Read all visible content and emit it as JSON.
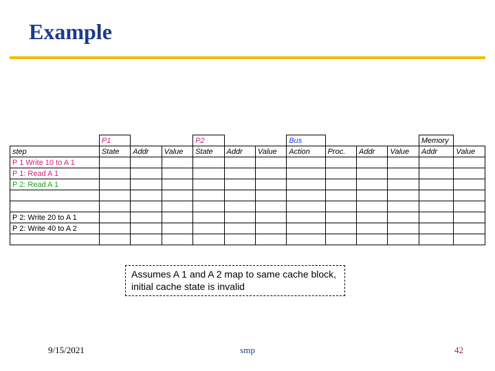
{
  "title": "Example",
  "headers": {
    "p1": "P1",
    "p2": "P2",
    "bus": "Bus",
    "memory": "Memory",
    "step": "step",
    "state": "State",
    "addr": "Addr",
    "value": "Value",
    "action": "Action",
    "proc": "Proc."
  },
  "steps": [
    {
      "label": "P 1 Write 10 to A 1",
      "class": "step-red"
    },
    {
      "label": "P 1: Read A 1",
      "class": "step-red"
    },
    {
      "label": "P 2: Read A 1",
      "class": "step-green"
    },
    {
      "label": "",
      "class": "step-shade"
    },
    {
      "label": "",
      "class": "step-shade"
    },
    {
      "label": "P 2: Write 20 to A 1",
      "class": "step-black"
    },
    {
      "label": "P 2: Write 40 to A 2",
      "class": "step-black"
    },
    {
      "label": "",
      "class": "step-shade"
    }
  ],
  "note": "Assumes A 1 and A 2 map to same cache block, initial cache state is invalid",
  "footer": {
    "date": "9/15/2021",
    "center": "smp",
    "page": "42"
  },
  "chart_data": {
    "type": "table",
    "title": "Example",
    "group_headers": [
      "",
      "P1",
      "P2",
      "Bus",
      "Memory"
    ],
    "columns": [
      "step",
      "State",
      "Addr",
      "Value",
      "State",
      "Addr",
      "Value",
      "Action",
      "Proc.",
      "Addr",
      "Value",
      "Addr",
      "Value"
    ],
    "rows": [
      [
        "P 1 Write 10 to A 1",
        "",
        "",
        "",
        "",
        "",
        "",
        "",
        "",
        "",
        "",
        "",
        ""
      ],
      [
        "P 1: Read A 1",
        "",
        "",
        "",
        "",
        "",
        "",
        "",
        "",
        "",
        "",
        "",
        ""
      ],
      [
        "P 2: Read A 1",
        "",
        "",
        "",
        "",
        "",
        "",
        "",
        "",
        "",
        "",
        "",
        ""
      ],
      [
        "",
        "",
        "",
        "",
        "",
        "",
        "",
        "",
        "",
        "",
        "",
        "",
        ""
      ],
      [
        "",
        "",
        "",
        "",
        "",
        "",
        "",
        "",
        "",
        "",
        "",
        "",
        ""
      ],
      [
        "P 2: Write 20 to A 1",
        "",
        "",
        "",
        "",
        "",
        "",
        "",
        "",
        "",
        "",
        "",
        ""
      ],
      [
        "P 2: Write 40 to A 2",
        "",
        "",
        "",
        "",
        "",
        "",
        "",
        "",
        "",
        "",
        "",
        ""
      ],
      [
        "",
        "",
        "",
        "",
        "",
        "",
        "",
        "",
        "",
        "",
        "",
        "",
        ""
      ]
    ],
    "note": "Assumes A 1 and A 2 map to same cache block, initial cache state is invalid"
  }
}
